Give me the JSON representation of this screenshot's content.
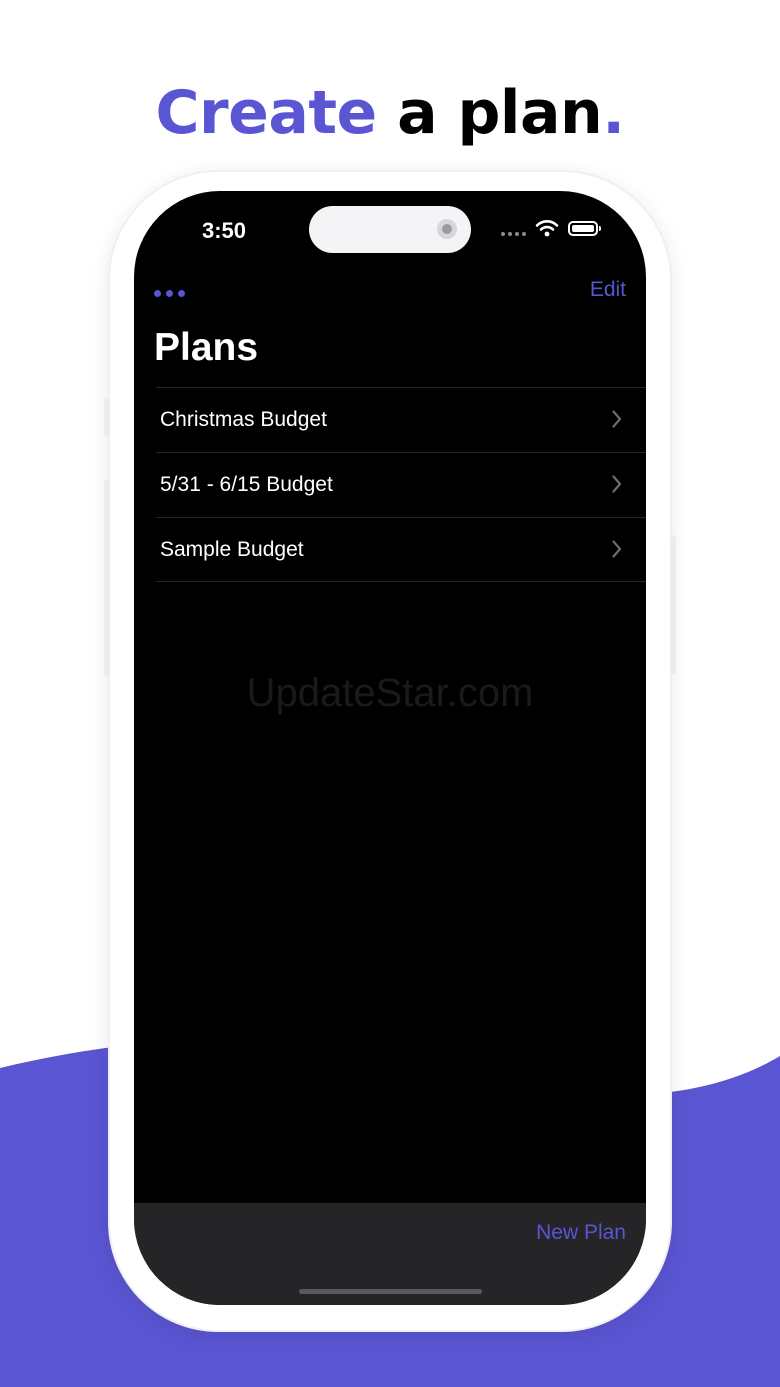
{
  "headline": {
    "accent_text": "Create",
    "rest_text": " a plan",
    "period": "."
  },
  "status_bar": {
    "time": "3:50",
    "icons": [
      "signal-dots-icon",
      "wifi-icon",
      "battery-icon"
    ]
  },
  "nav": {
    "more_icon": "ellipsis-icon",
    "edit_label": "Edit",
    "title": "Plans"
  },
  "plans": [
    {
      "label": "Christmas Budget"
    },
    {
      "label": "5/31 - 6/15 Budget"
    },
    {
      "label": "Sample Budget"
    }
  ],
  "watermark": "UpdateStar.com",
  "toolbar": {
    "new_plan_label": "New Plan"
  },
  "colors": {
    "accent": "#5a55d2",
    "screen_background": "#000000",
    "toolbar_background": "#252527",
    "page_background": "#ffffff"
  }
}
